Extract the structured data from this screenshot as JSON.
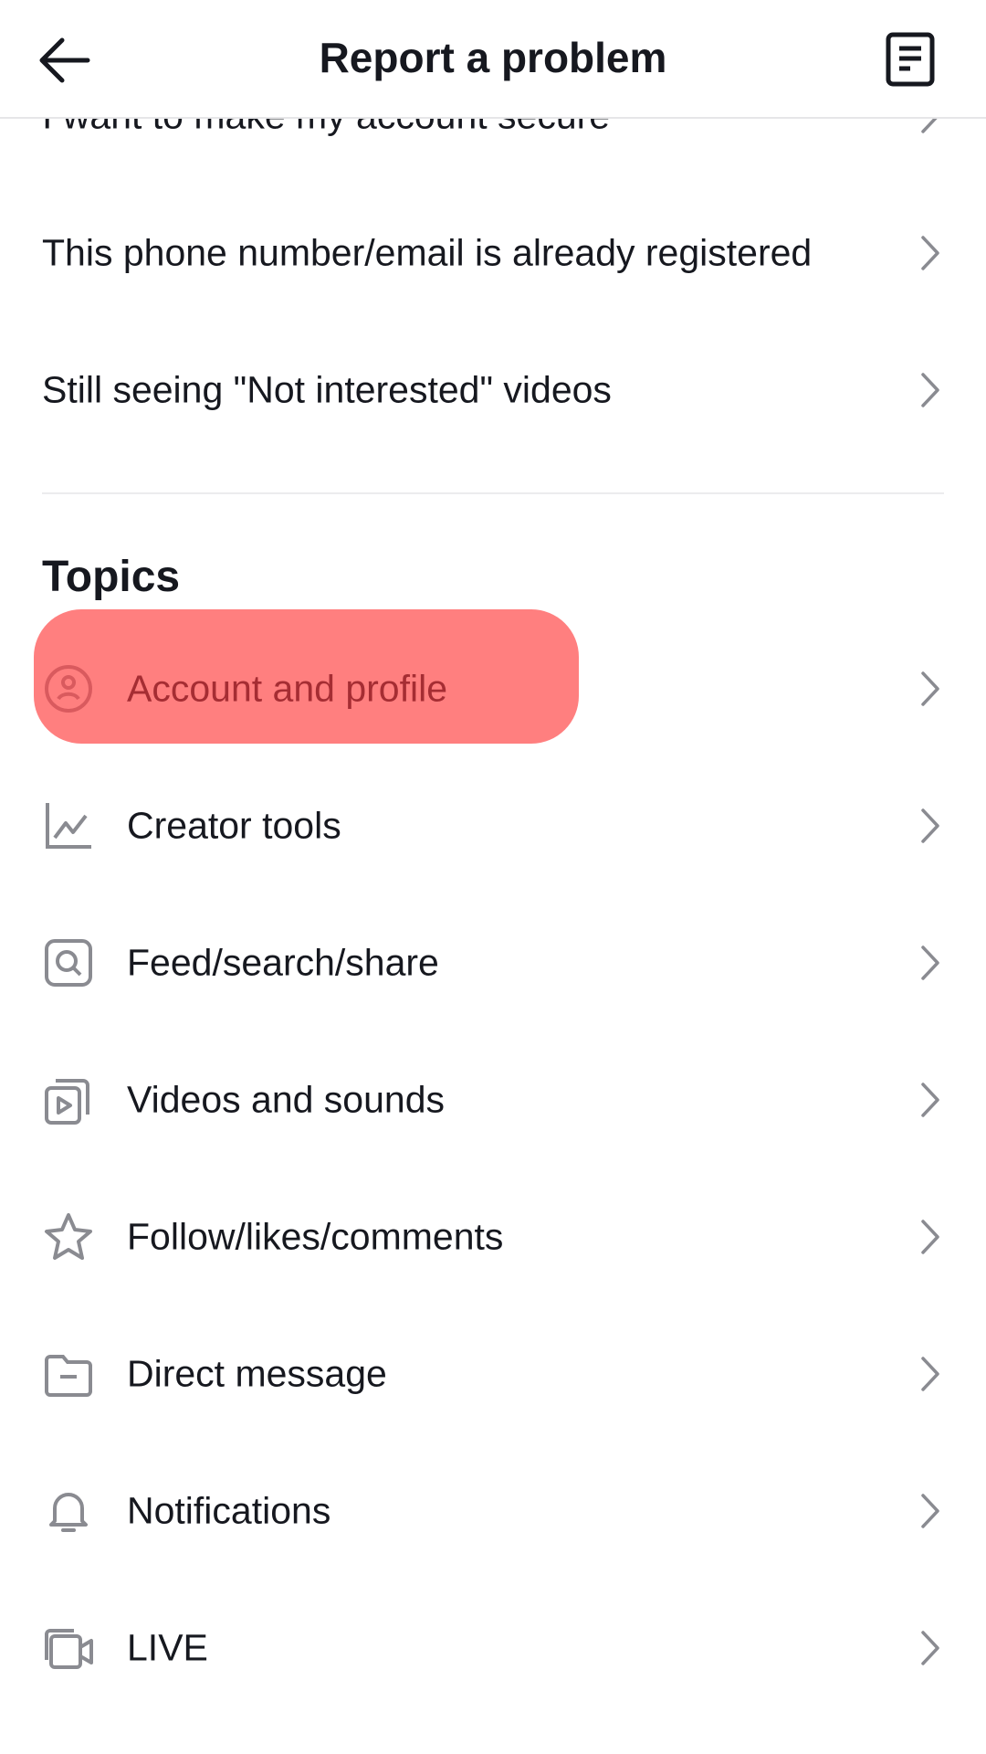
{
  "header": {
    "title": "Report a problem",
    "back_icon": "arrow-left-icon",
    "history_icon": "document-list-icon"
  },
  "suggested": [
    {
      "label": "I want to make my account secure"
    },
    {
      "label": "This phone number/email is already registered"
    },
    {
      "label": "Still seeing \"Not interested\" videos"
    }
  ],
  "topics": {
    "heading": "Topics",
    "items": [
      {
        "label": "Account and profile",
        "icon": "user-circle-icon",
        "highlighted": true
      },
      {
        "label": "Creator tools",
        "icon": "line-chart-icon"
      },
      {
        "label": "Feed/search/share",
        "icon": "search-square-icon"
      },
      {
        "label": "Videos and sounds",
        "icon": "video-stack-icon"
      },
      {
        "label": "Follow/likes/comments",
        "icon": "star-icon"
      },
      {
        "label": "Direct message",
        "icon": "folder-icon"
      },
      {
        "label": "Notifications",
        "icon": "bell-icon"
      },
      {
        "label": "LIVE",
        "icon": "live-camera-icon"
      }
    ]
  },
  "colors": {
    "highlight": "#ff7f7f",
    "highlight_text": "#a52d33",
    "icon_gray": "#8a8b91",
    "text": "#16181f"
  }
}
